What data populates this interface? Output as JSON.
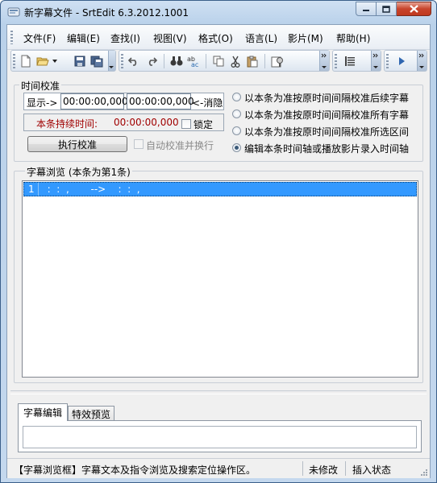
{
  "window": {
    "title": "新字幕文件 - SrtEdit 6.3.2012.1001",
    "controls": {
      "minimize": "minimize",
      "maximize": "maximize",
      "close": "close"
    }
  },
  "menu": {
    "file": "文件(F)",
    "edit": "编辑(E)",
    "find": "查找(I)",
    "view": "视图(V)",
    "format": "格式(O)",
    "language": "语言(L)",
    "movie": "影片(M)",
    "help": "帮助(H)"
  },
  "toolbar": {
    "icons": [
      "new-file-icon",
      "open-folder-icon",
      "save-icon",
      "save-all-icon",
      "undo-icon",
      "redo-icon",
      "find-icon",
      "replace-icon",
      "copy-icon",
      "cut-icon",
      "paste-icon",
      "properties-icon",
      "list-icon",
      "play-icon"
    ]
  },
  "timing": {
    "group_label": "时间校准",
    "display_label": "显示->",
    "start_time": "00:00:00,000",
    "end_time": "00:00:00,000",
    "hide_label": "<-消隐",
    "duration_label": "本条持续时间:",
    "duration_value": "00:00:00,000",
    "lock_label": "锁定",
    "execute_button": "执行校准",
    "auto_label": "自动校准并换行",
    "options": [
      "以本条为准按原时间间隔校准后续字幕",
      "以本条为准按原时间间隔校准所有字幕",
      "以本条为准按原时间间隔校准所选区间",
      "编辑本条时间轴或播放影片录入时间轴"
    ],
    "selected_option": 3
  },
  "browser": {
    "group_label": "字幕浏览 (本条为第1条)",
    "rows": [
      {
        "num": "1",
        "text": "  :  :  ,       -->    :  :  ,"
      }
    ]
  },
  "editor": {
    "tabs": [
      "字幕编辑",
      "特效预览"
    ],
    "active_tab": 0,
    "content": ""
  },
  "status": {
    "message": "【字幕浏览框】字幕文本及指令浏览及搜索定位操作区。",
    "modified": "未修改",
    "mode": "插入状态"
  },
  "colors": {
    "accent": "#3399ff",
    "duration_text": "#a00000"
  }
}
